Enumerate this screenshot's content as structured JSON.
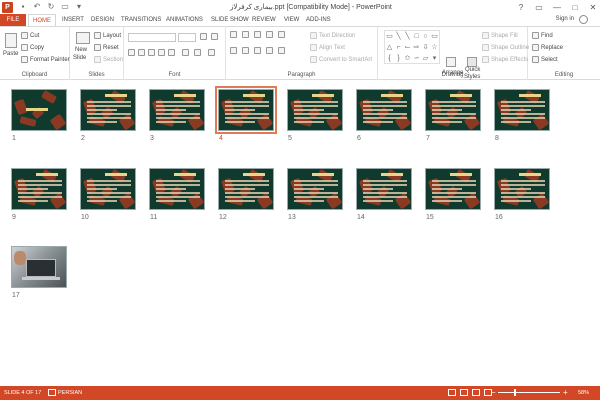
{
  "window": {
    "title": "بیماری کرفرلاز.ppt [Compatibility Mode] - PowerPoint",
    "controls": [
      "?",
      "▭",
      "—",
      "□",
      "✕"
    ]
  },
  "tabs": [
    "FILE",
    "HOME",
    "INSERT",
    "DESIGN",
    "TRANSITIONS",
    "ANIMATIONS",
    "SLIDE SHOW",
    "REVIEW",
    "VIEW",
    "ADD-INS"
  ],
  "active_tab": "HOME",
  "signin": "Sign in",
  "ribbon": {
    "clipboard": {
      "paste": "Paste",
      "cut": "Cut",
      "copy": "Copy",
      "format_painter": "Format Painter",
      "label": "Clipboard"
    },
    "slides": {
      "new_slide": "New",
      "new_slide2": "Slide",
      "layout": "Layout",
      "reset": "Reset",
      "section": "Section",
      "label": "Slides"
    },
    "font": {
      "label": "Font"
    },
    "paragraph": {
      "text_direction": "Text Direction",
      "align_text": "Align Text",
      "convert_smartart": "Convert to SmartArt",
      "label": "Paragraph"
    },
    "drawing": {
      "arrange": "Arrange",
      "quick_styles": "Quick",
      "quick_styles2": "Styles",
      "shape_fill": "Shape Fill",
      "shape_outline": "Shape Outline",
      "shape_effects": "Shape Effects",
      "label": "Drawing"
    },
    "editing": {
      "find": "Find",
      "replace": "Replace",
      "select": "Select",
      "label": "Editing"
    }
  },
  "slides": [
    {
      "num": "1"
    },
    {
      "num": "2"
    },
    {
      "num": "3"
    },
    {
      "num": "4"
    },
    {
      "num": "5"
    },
    {
      "num": "6"
    },
    {
      "num": "7"
    },
    {
      "num": "8"
    },
    {
      "num": "9"
    },
    {
      "num": "10"
    },
    {
      "num": "11"
    },
    {
      "num": "12"
    },
    {
      "num": "13"
    },
    {
      "num": "14"
    },
    {
      "num": "15"
    },
    {
      "num": "16"
    },
    {
      "num": "17"
    }
  ],
  "selected_slide": "4",
  "status": {
    "slide_info": "SLIDE 4 OF 17",
    "language": "PERSIAN",
    "zoom": "58%",
    "minus": "−",
    "plus": "+"
  },
  "colors": {
    "accent": "#d24726",
    "slide_bg": "#0f3a2d",
    "slide_shape": "#8a3a22"
  }
}
